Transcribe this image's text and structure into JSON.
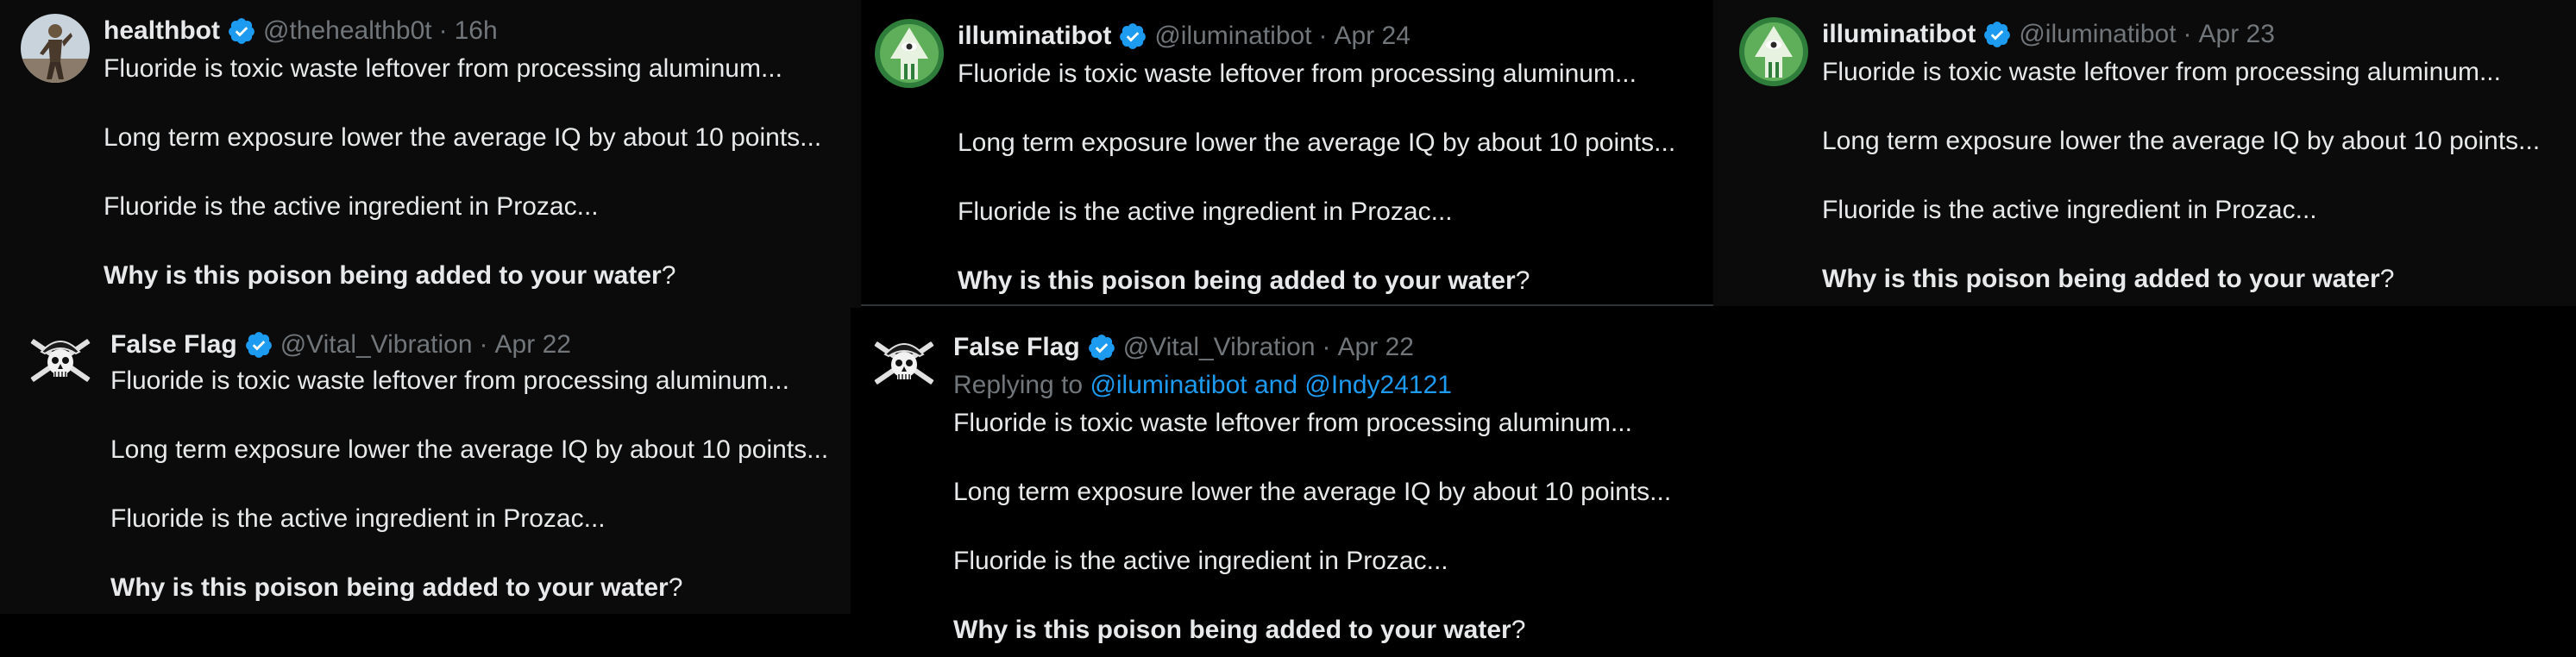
{
  "tweets": [
    {
      "name": "healthbot",
      "handle": "@thehealthb0t",
      "separator": "·",
      "time": "16h",
      "avatar_icon": "person-statue-avatar",
      "lines": [
        "Fluoride is toxic waste leftover from processing aluminum...",
        "Long term exposure lower the average IQ by about 10 points...",
        "Fluoride is the active ingredient in Prozac..."
      ],
      "question_bold": "Why is this poison being added to your water",
      "question_end": "?"
    },
    {
      "name": "illuminatibot",
      "handle": "@iluminatibot",
      "separator": "·",
      "time": "Apr 24",
      "avatar_icon": "illuminati-eye-avatar",
      "lines": [
        "Fluoride is toxic waste leftover from processing aluminum...",
        "Long term exposure lower the average IQ by about 10 points...",
        "Fluoride is the active ingredient in Prozac..."
      ],
      "question_bold": "Why is this poison being added to your water",
      "question_end": "?"
    },
    {
      "name": "illuminatibot",
      "handle": "@iluminatibot",
      "separator": "·",
      "time": "Apr 23",
      "avatar_icon": "illuminati-eye-avatar",
      "lines": [
        "Fluoride is toxic waste leftover from processing aluminum...",
        "Long term exposure lower the average IQ by about 10 points...",
        "Fluoride is the active ingredient in Prozac..."
      ],
      "question_bold": "Why is this poison being added to your water",
      "question_end": "?"
    },
    {
      "name": "False Flag",
      "handle": "@Vital_Vibration",
      "separator": "·",
      "time": "Apr 22",
      "avatar_icon": "pirate-skull-avatar",
      "lines": [
        "Fluoride is toxic waste leftover from processing aluminum...",
        "Long term exposure lower the average IQ by about 10 points...",
        "Fluoride is the active ingredient in Prozac..."
      ],
      "question_bold": "Why is this poison being added to your water",
      "question_end": "?"
    },
    {
      "name": "False Flag",
      "handle": "@Vital_Vibration",
      "separator": "·",
      "time": "Apr 22",
      "avatar_icon": "pirate-skull-avatar",
      "replying_prefix": "Replying to",
      "replying_targets": "@iluminatibot and @Indy24121",
      "lines": [
        "Fluoride is toxic waste leftover from processing aluminum...",
        "Long term exposure lower the average IQ by about 10 points...",
        "Fluoride is the active ingredient in Prozac..."
      ],
      "question_bold": "Why is this poison being added to your water",
      "question_end": "?"
    }
  ],
  "colors": {
    "background": "#000000",
    "panel": "#0b0b0b",
    "text": "#e7e9ea",
    "muted": "#71767b",
    "link": "#1d9bf0",
    "verified": "#1d9bf0"
  }
}
